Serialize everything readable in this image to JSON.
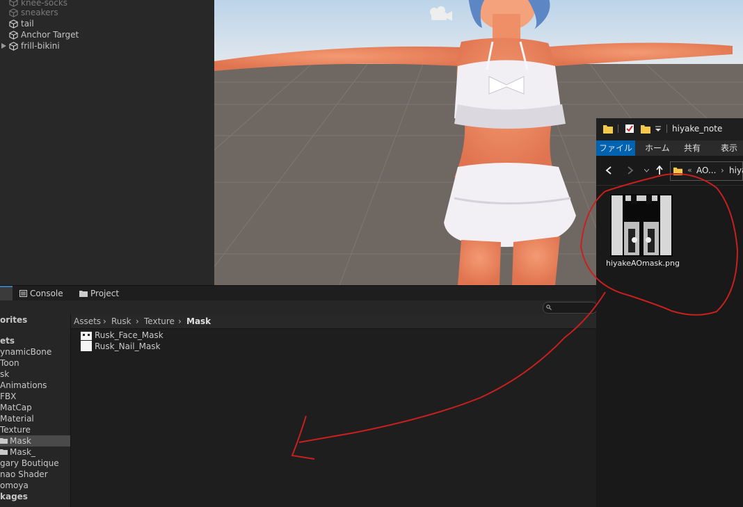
{
  "hierarchy": {
    "items": [
      {
        "label": "knee-socks",
        "dim": true
      },
      {
        "label": "sneakers",
        "dim": true
      },
      {
        "label": "tail",
        "dim": false
      },
      {
        "label": "Anchor Target",
        "dim": false
      },
      {
        "label": "frill-bikini",
        "dim": false
      }
    ]
  },
  "bottom_tabs": {
    "console_label": "Console",
    "project_label": "Project"
  },
  "favorites": {
    "items": [
      "orites",
      "",
      "ets",
      "ynamicBone",
      "Toon",
      "sk",
      "Animations",
      "FBX",
      "MatCap",
      "Material",
      "Texture",
      "Mask",
      "Mask_",
      "gary Boutique",
      "nao Shader",
      "omoya",
      "kages"
    ]
  },
  "breadcrumb": {
    "parts": [
      "Assets",
      "Rusk",
      "Texture",
      "Mask"
    ],
    "separator": "›"
  },
  "assets": {
    "items": [
      "Rusk_Face_Mask",
      "Rusk_Nail_Mask"
    ]
  },
  "explorer": {
    "title": "hiyake_note",
    "ribbon": [
      "ファイル",
      "ホーム",
      "共有",
      "表示"
    ],
    "address": {
      "prefix": "«",
      "part1": "AO...",
      "sep": "›",
      "part2": "hiya"
    },
    "file_name": "hiyakeAOmask.png"
  },
  "colors": {
    "annotation_red": "#c8201e",
    "ribbon_active": "#0063b1"
  }
}
